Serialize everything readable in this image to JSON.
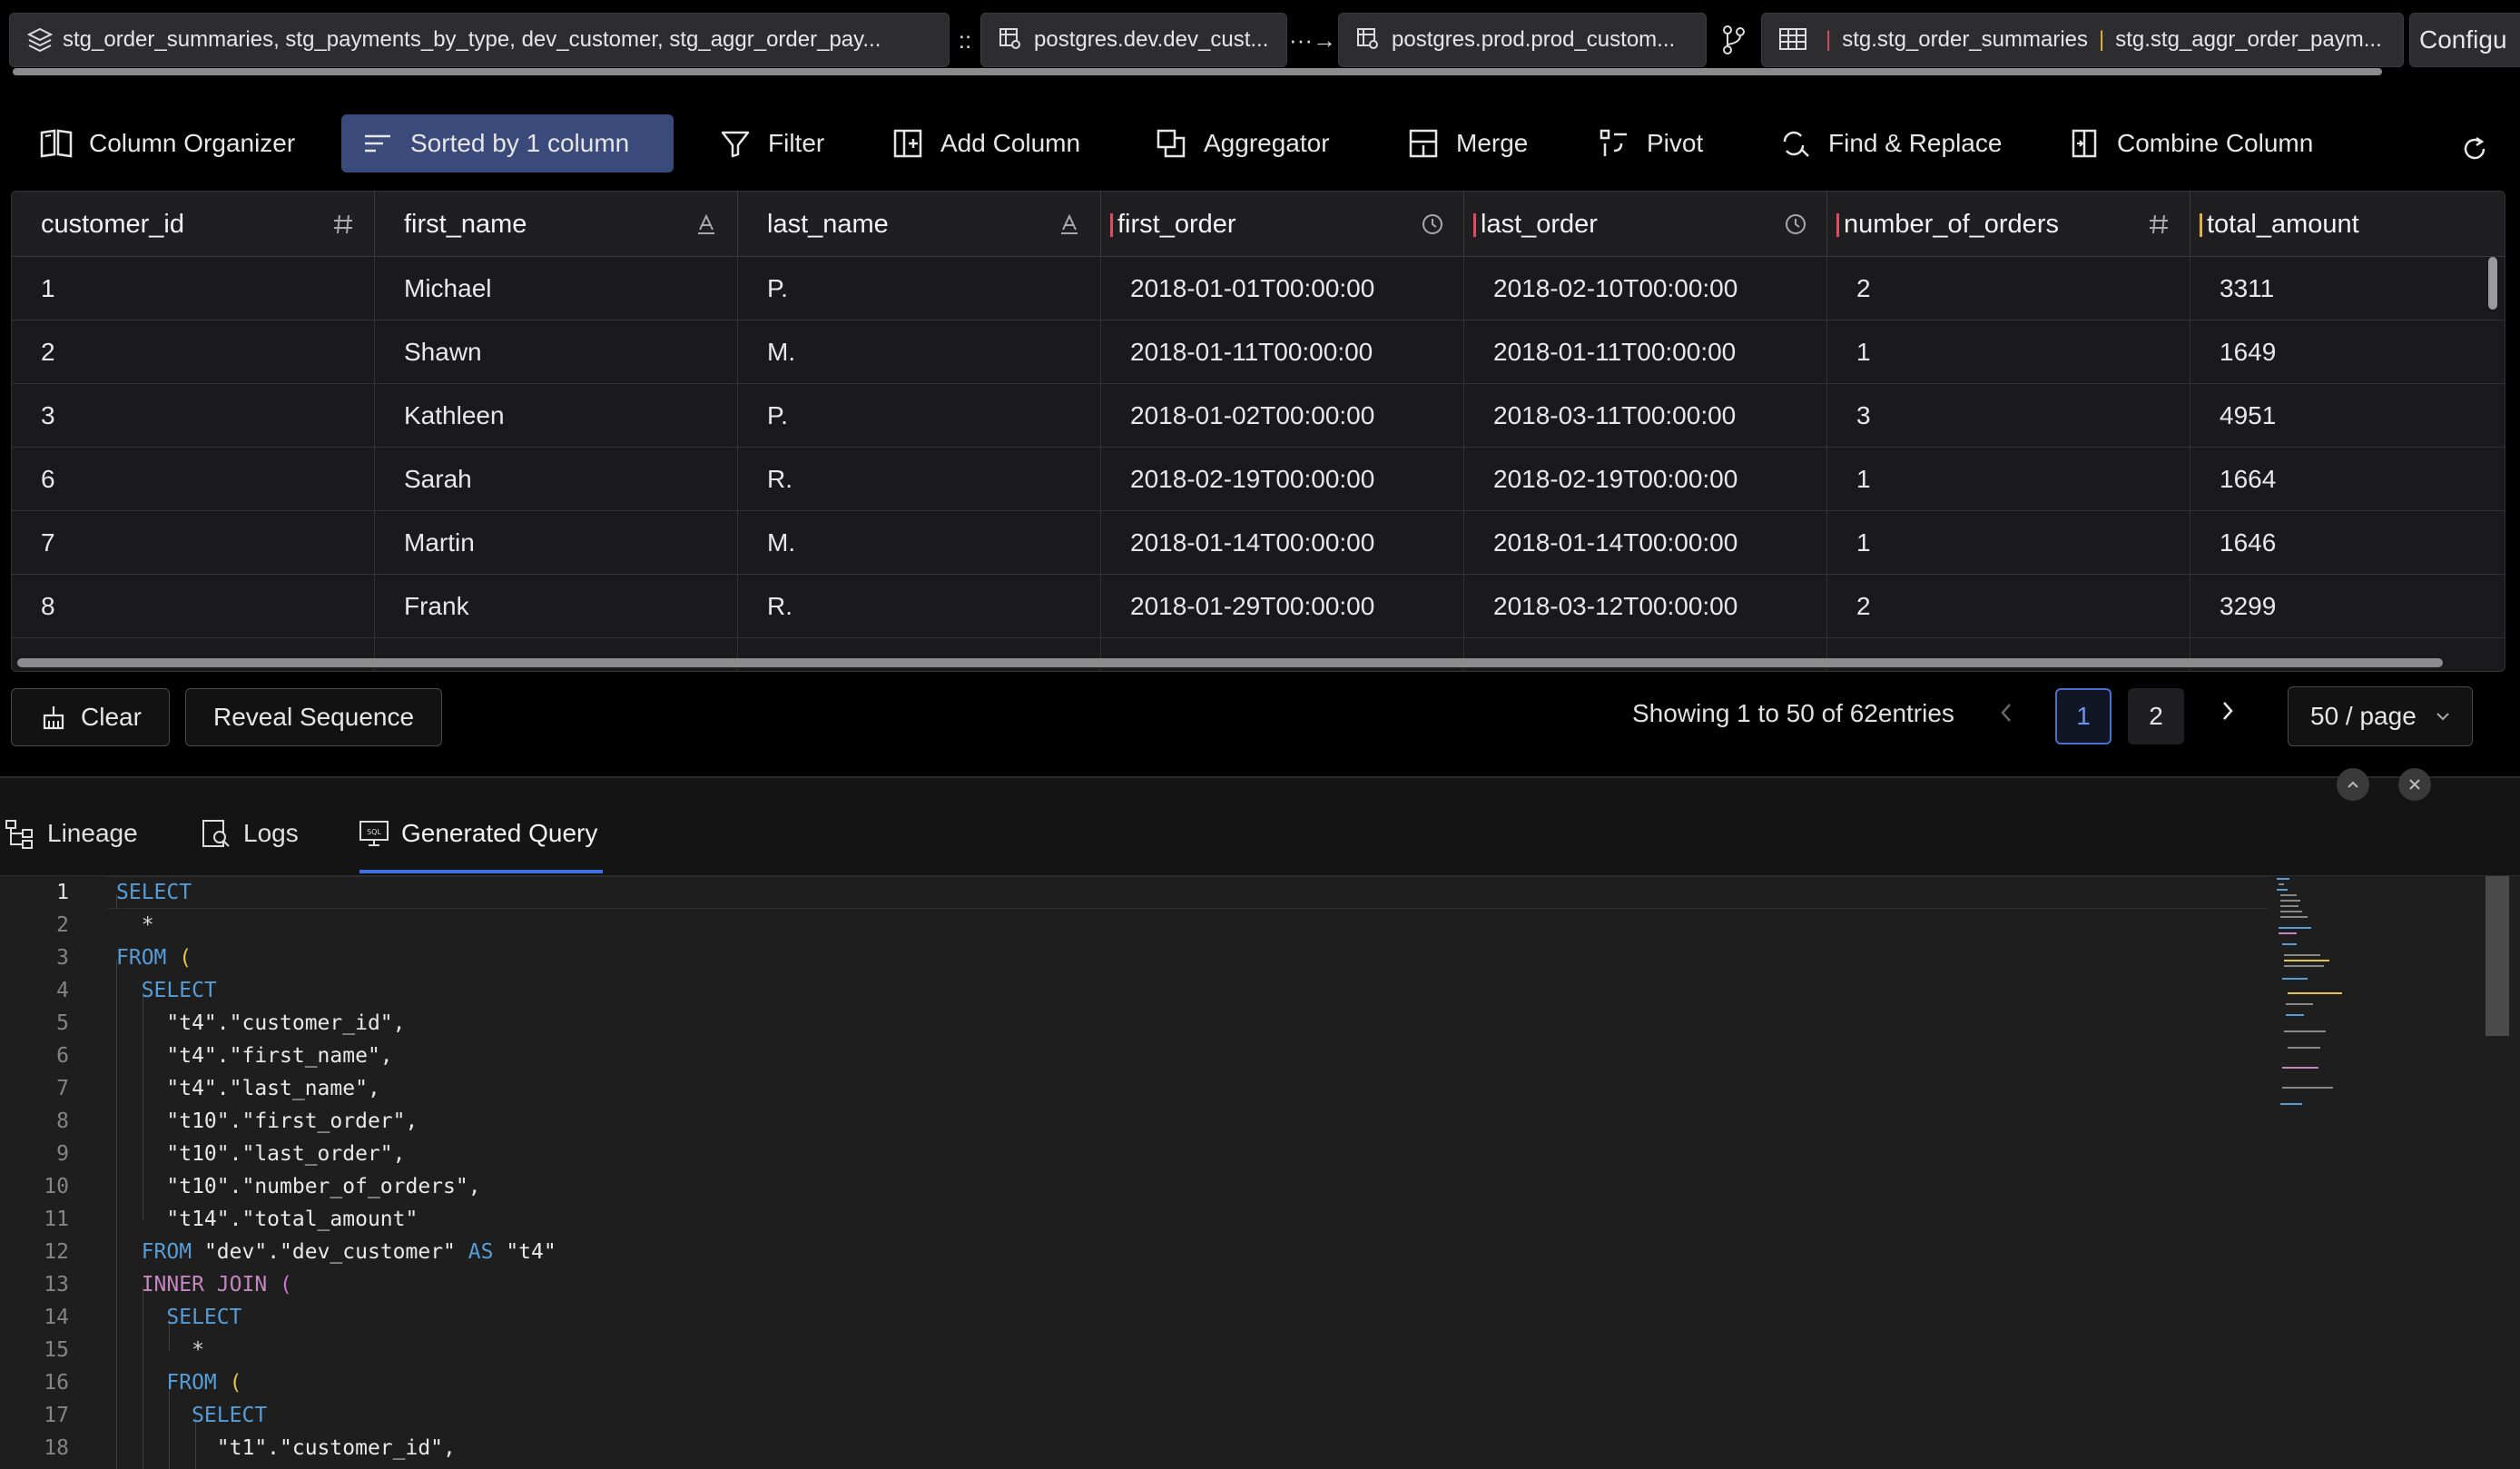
{
  "tabs": {
    "items": [
      {
        "label": "stg_order_summaries, stg_payments_by_type, dev_customer, stg_aggr_order_pay..."
      },
      {
        "label": "postgres.dev.dev_cust..."
      },
      {
        "label": "postgres.prod.prod_custom..."
      }
    ],
    "sep_colon": "::",
    "sep_arrow": "···→",
    "stack_tab": {
      "part1": "stg.stg_order_summaries",
      "part2": "stg.stg_aggr_order_paym..."
    },
    "overflow_label": "Configu"
  },
  "toolbar": {
    "column_organizer": "Column Organizer",
    "sorted": "Sorted by 1 column",
    "filter": "Filter",
    "add_column": "Add Column",
    "aggregator": "Aggregator",
    "merge": "Merge",
    "pivot": "Pivot",
    "find_replace": "Find & Replace",
    "combine_column": "Combine Column"
  },
  "grid": {
    "columns": [
      {
        "name": "customer_id",
        "type_icon": "hash-icon"
      },
      {
        "name": "first_name",
        "type_icon": "text-icon"
      },
      {
        "name": "last_name",
        "type_icon": "text-icon"
      },
      {
        "name": "first_order",
        "type_icon": "clock-icon"
      },
      {
        "name": "last_order",
        "type_icon": "clock-icon"
      },
      {
        "name": "number_of_orders",
        "type_icon": "hash-icon"
      },
      {
        "name": "total_amount",
        "type_icon": ""
      }
    ],
    "rows": [
      [
        "1",
        "Michael",
        "P.",
        "2018-01-01T00:00:00",
        "2018-02-10T00:00:00",
        "2",
        "3311"
      ],
      [
        "2",
        "Shawn",
        "M.",
        "2018-01-11T00:00:00",
        "2018-01-11T00:00:00",
        "1",
        "1649"
      ],
      [
        "3",
        "Kathleen",
        "P.",
        "2018-01-02T00:00:00",
        "2018-03-11T00:00:00",
        "3",
        "4951"
      ],
      [
        "6",
        "Sarah",
        "R.",
        "2018-02-19T00:00:00",
        "2018-02-19T00:00:00",
        "1",
        "1664"
      ],
      [
        "7",
        "Martin",
        "M.",
        "2018-01-14T00:00:00",
        "2018-01-14T00:00:00",
        "1",
        "1646"
      ],
      [
        "8",
        "Frank",
        "R.",
        "2018-01-29T00:00:00",
        "2018-03-12T00:00:00",
        "2",
        "3299"
      ]
    ]
  },
  "footer": {
    "clear": "Clear",
    "reveal": "Reveal Sequence",
    "showing": "Showing 1 to 50 of 62entries",
    "pages": [
      "1",
      "2"
    ],
    "page_size": "50 / page"
  },
  "panel": {
    "tabs": [
      "Lineage",
      "Logs",
      "Generated Query"
    ]
  },
  "query": {
    "lines": [
      "SELECT",
      "  *",
      "FROM (",
      "  SELECT",
      "    \"t4\".\"customer_id\",",
      "    \"t4\".\"first_name\",",
      "    \"t4\".\"last_name\",",
      "    \"t10\".\"first_order\",",
      "    \"t10\".\"last_order\",",
      "    \"t10\".\"number_of_orders\",",
      "    \"t14\".\"total_amount\"",
      "  FROM \"dev\".\"dev_customer\" AS \"t4\"",
      "  INNER JOIN (",
      "    SELECT",
      "      *",
      "    FROM (",
      "      SELECT",
      "        \"t1\".\"customer_id\","
    ]
  },
  "colors": {
    "accent": "#3f6fe0",
    "active_toolbar": "#3a4a7a",
    "keyword": "#569cd6",
    "keyword_join": "#c586c0",
    "paren": "#e3c44a",
    "column_marker": "#e04a5f"
  }
}
